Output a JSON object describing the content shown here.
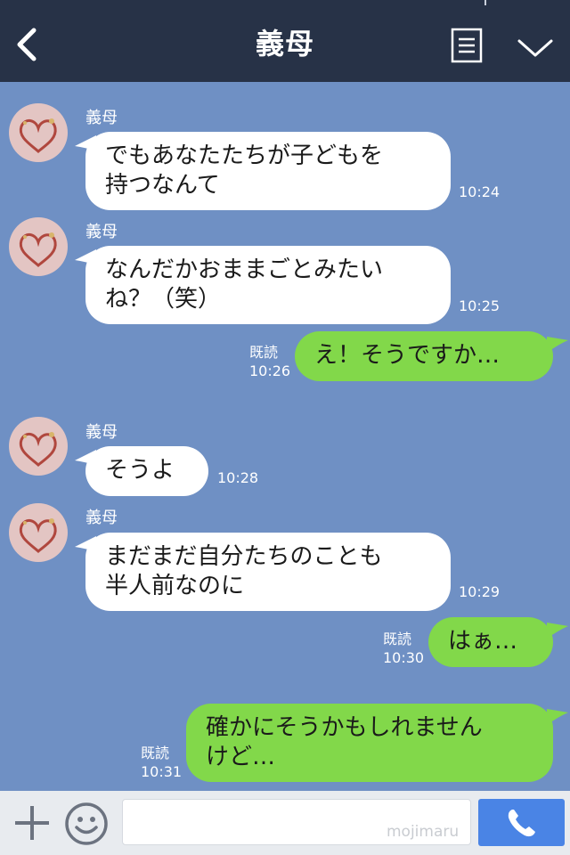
{
  "header": {
    "title": "義母"
  },
  "messages": [
    {
      "side": "in",
      "sender": "義母",
      "text": "でもあなたたちが子どもを\n持つなんて",
      "time": "10:24"
    },
    {
      "side": "in",
      "sender": "義母",
      "text": "なんだかおままごとみたい\nね？（笑）",
      "time": "10:25"
    },
    {
      "side": "out",
      "read": "既読",
      "text": "え！そうですか…",
      "time": "10:26"
    },
    {
      "side": "in",
      "sender": "義母",
      "text": "そうよ",
      "time": "10:28"
    },
    {
      "side": "in",
      "sender": "義母",
      "text": "まだまだ自分たちのことも\n半人前なのに",
      "time": "10:29"
    },
    {
      "side": "out",
      "read": "既読",
      "text": "はぁ…",
      "time": "10:30"
    },
    {
      "side": "out",
      "read": "既読",
      "text": "確かにそうかもしれません\nけど…",
      "time": "10:31"
    }
  ],
  "input": {
    "placeholder": "",
    "watermark": "mojimaru"
  },
  "icons": {
    "back": "chevron-left-icon",
    "menu": "notes-icon",
    "more": "chevron-down-icon",
    "add": "plus-icon",
    "emoji": "smiley-icon",
    "send": "phone-icon"
  },
  "colors": {
    "header": "#273247",
    "background": "#6f90c4",
    "outgoing": "#82d84a",
    "incoming": "#ffffff",
    "send": "#4a84e5"
  }
}
